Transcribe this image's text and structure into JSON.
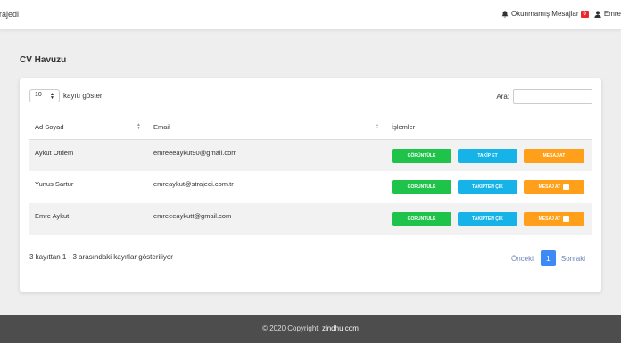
{
  "header": {
    "brand": "rajedi",
    "notifications_label": "Okunmamış Mesajlar",
    "notifications_count": "0",
    "user_name": "Emre"
  },
  "page": {
    "title": "CV Havuzu"
  },
  "table_controls": {
    "length_value": "10",
    "length_label": "kayıtı göster",
    "search_label": "Ara:",
    "search_value": ""
  },
  "table": {
    "columns": [
      "Ad Soyad",
      "Email",
      "İşlemler"
    ],
    "rows": [
      {
        "name": "Aykut Otdem",
        "email": "emreeeaykut90@gmail.com",
        "actions": [
          "GÖRÜNTÜLE",
          "TAKİP ET",
          "MESAJ AT"
        ]
      },
      {
        "name": "Yunus Sartur",
        "email": "emreaykut@strajedi.com.tr",
        "actions": [
          "GÖRÜNTÜLE",
          "TAKİPTEN ÇIK",
          "MESAJ AT"
        ]
      },
      {
        "name": "Emre Aykut",
        "email": "emreeeaykutt@gmail.com",
        "actions": [
          "GÖRÜNTÜLE",
          "TAKİPTEN ÇIK",
          "MESAJ AT"
        ]
      }
    ]
  },
  "info_text": "3 kayıttan 1 - 3 arasındaki kayıtlar gösteriliyor",
  "pagination": {
    "prev": "Önceki",
    "current": "1",
    "next": "Sonraki"
  },
  "footer": {
    "text": "© 2020 Copyright:",
    "link": "zindhu.com"
  },
  "colors": {
    "view": "#1fc34a",
    "follow": "#15b3e8",
    "message": "#ff9f1a",
    "badge": "#e8282b",
    "page_active": "#3d8af7"
  }
}
